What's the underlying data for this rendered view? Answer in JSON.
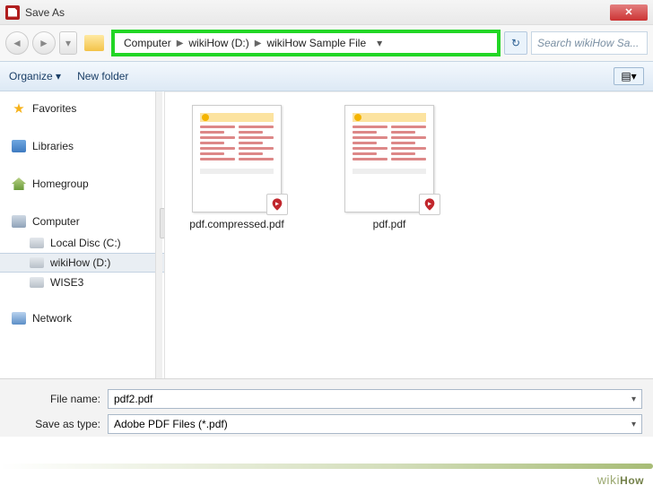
{
  "window": {
    "title": "Save As"
  },
  "nav": {
    "breadcrumb": [
      "Computer",
      "wikiHow (D:)",
      "wikiHow Sample File"
    ],
    "search_placeholder": "Search wikiHow Sa..."
  },
  "toolbar": {
    "organize": "Organize ▾",
    "newfolder": "New folder"
  },
  "tree": {
    "favorites": "Favorites",
    "libraries": "Libraries",
    "homegroup": "Homegroup",
    "computer": "Computer",
    "drives": [
      {
        "label": "Local Disc (C:)"
      },
      {
        "label": "wikiHow (D:)"
      },
      {
        "label": "WISE3"
      }
    ],
    "network": "Network"
  },
  "files": [
    {
      "name": "pdf.compressed.pdf"
    },
    {
      "name": "pdf.pdf"
    }
  ],
  "form": {
    "filename_label": "File name:",
    "filename_value": "pdf2.pdf",
    "savetype_label": "Save as type:",
    "savetype_value": "Adobe PDF Files (*.pdf)"
  },
  "watermark": "wikiHow"
}
